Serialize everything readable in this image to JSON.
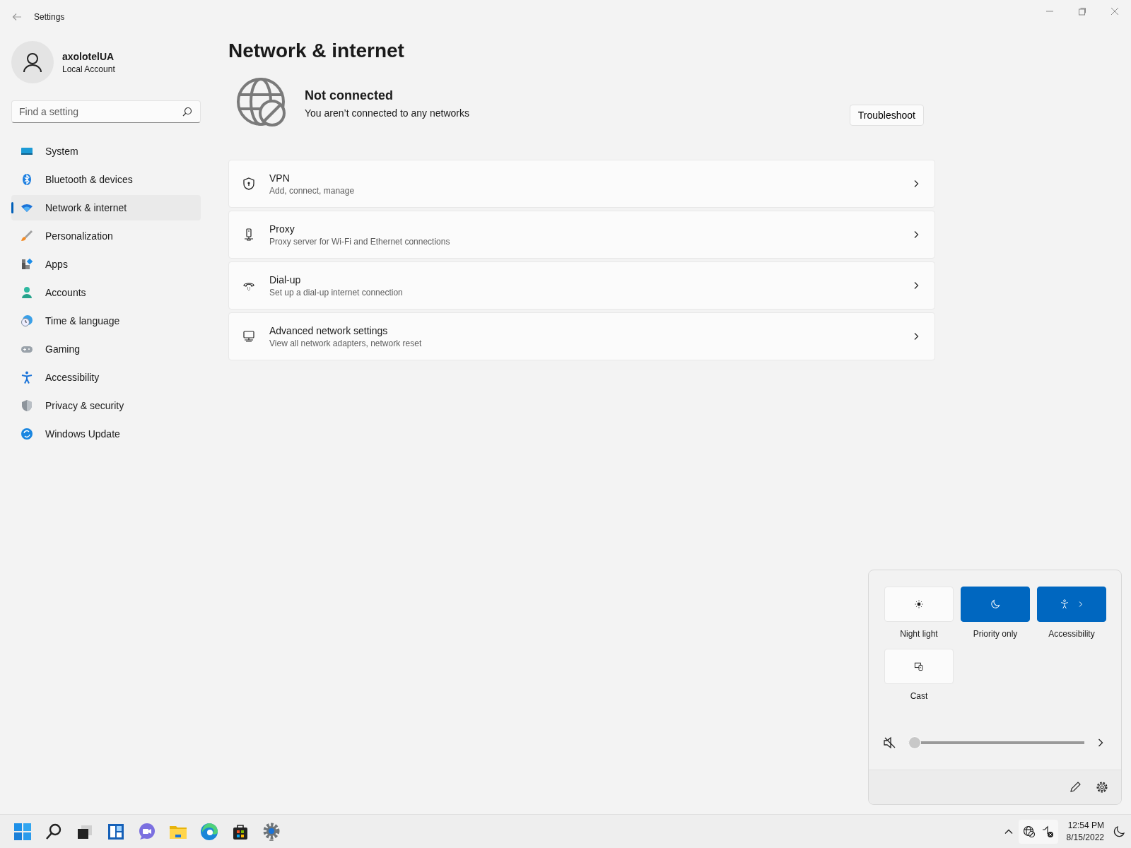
{
  "window": {
    "title": "Settings"
  },
  "account": {
    "name": "axolotelUA",
    "type": "Local Account"
  },
  "search": {
    "placeholder": "Find a setting"
  },
  "nav": [
    {
      "label": "System",
      "selected": false
    },
    {
      "label": "Bluetooth & devices",
      "selected": false
    },
    {
      "label": "Network & internet",
      "selected": true
    },
    {
      "label": "Personalization",
      "selected": false
    },
    {
      "label": "Apps",
      "selected": false
    },
    {
      "label": "Accounts",
      "selected": false
    },
    {
      "label": "Time & language",
      "selected": false
    },
    {
      "label": "Gaming",
      "selected": false
    },
    {
      "label": "Accessibility",
      "selected": false
    },
    {
      "label": "Privacy & security",
      "selected": false
    },
    {
      "label": "Windows Update",
      "selected": false
    }
  ],
  "page": {
    "title": "Network & internet",
    "status": "Not connected",
    "status_detail": "You aren’t connected to any networks",
    "action": "Troubleshoot"
  },
  "cards": [
    {
      "title": "VPN",
      "subtitle": "Add, connect, manage"
    },
    {
      "title": "Proxy",
      "subtitle": "Proxy server for Wi-Fi and Ethernet connections"
    },
    {
      "title": "Dial-up",
      "subtitle": "Set up a dial-up internet connection"
    },
    {
      "title": "Advanced network settings",
      "subtitle": "View all network adapters, network reset"
    }
  ],
  "quick_settings": {
    "tiles": [
      {
        "label": "Night light",
        "on": false
      },
      {
        "label": "Priority only",
        "on": true
      },
      {
        "label": "Accessibility",
        "on": true
      },
      {
        "label": "Cast",
        "on": false
      }
    ],
    "volume": {
      "muted": true,
      "level": 0
    }
  },
  "taskbar": {
    "time": "12:54 PM",
    "date": "8/15/2022"
  }
}
